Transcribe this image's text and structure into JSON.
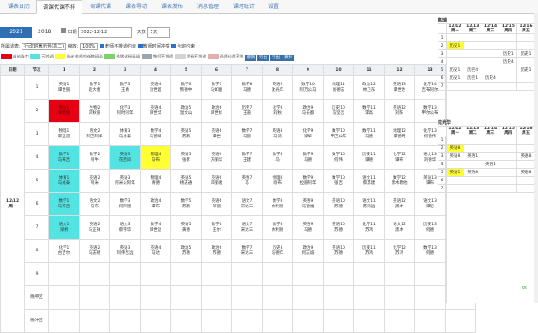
{
  "nav": [
    "课表日历",
    "调课代课不排",
    "调课代课",
    "课表导动",
    "课表发布",
    "消息管理",
    "课时统计",
    "设置"
  ],
  "nav_active": 2,
  "year": {
    "a": "2021",
    "b": "2018"
  },
  "date_label": "日期",
  "date_value": "2022-12-12",
  "days_label": "天数",
  "days_value": "5天",
  "row2": {
    "class_label": "所属课表:",
    "class_value": "行政班满示例(高二)",
    "zoom_label": "缩放:",
    "zoom_value": "100%",
    "opt1": "教师不排课约束",
    "opt2": "教师时间冲突",
    "opt3": "合班约束"
  },
  "legend": [
    {
      "color": "#e60012",
      "label": "当前选中"
    },
    {
      "color": "#54e3e3",
      "label": "可对调"
    },
    {
      "color": "#ffff33",
      "label": "当前老师的任教班级"
    },
    {
      "color": "#7ad36b",
      "label": "关联课程班级"
    },
    {
      "color": "#9aa5ad",
      "label": "教师不排课"
    },
    {
      "color": "#d3d3d3",
      "label": "课程不排课"
    },
    {
      "color": "#e0b0b0",
      "label": "调课代课不排"
    }
  ],
  "buttons": [
    "撤销",
    "导出",
    "导出",
    "教师"
  ],
  "table": {
    "h_date": "日期",
    "h_period": "节次",
    "cols": [
      "1",
      "2",
      "3",
      "4",
      "5",
      "6",
      "7",
      "8",
      "9",
      "10",
      "11",
      "12",
      "13",
      "14"
    ],
    "date": "12/12",
    "weekday": "周一",
    "rows": [
      {
        "p": "1",
        "cells": [
          "英语1\n谭世丽",
          "数学1\n赵大春",
          "数学3\n王清",
          "英语4\n汤世超",
          "数学6\n熊德中",
          "数学7\n马如酸",
          "数学8\n马德",
          "英语9\n沈光年",
          "数学10\n阿万公马",
          "地理11\n尚德志",
          "政治12\n林卫东",
          "英语13\n谭世达",
          "化学14\n吉布阿尔",
          "数学15\n钱小"
        ]
      },
      {
        "p": "2",
        "cells": [
          "英语1\n谭世丽",
          "生物2\n邓秋丽",
          "化学3\n阿时阿年",
          "英语4\n谭世华",
          "政治5\n温文山",
          "政治6\n谭世标",
          "历史7\n王道",
          "化学8\n刘秋",
          "政治9\n马长都",
          "历史10\n马坚吉",
          "数学11\n李高",
          "英语12\n刘阳",
          "数学13\n甲尔公布",
          "生物14\n阿布公布"
        ]
      },
      {
        "p": "3",
        "cells": [
          "物理1\n李正道",
          "语文2\n阿巴阿年",
          "体育3\n马永泰",
          "数学4\n马德华",
          "英语5\n苏鹏",
          "英语6\n谭世",
          "数学7\n马丽",
          "英语8\n马涛",
          "化学9\n梁华",
          "数学10\n甲巴公布",
          "数学11\n马德",
          "地理12\n谭德明",
          "化学13\n何德伟",
          "语文14\n吉布"
        ]
      },
      {
        "p": "4",
        "cells": [
          "数学1\n马布吉",
          "数学2\n阿牛",
          "英语3\n花西凤",
          "物理4\n马布",
          "英语5\n张孝",
          "英语6\n方丽华",
          "数学7\n王建",
          "数学8\n马",
          "数学9\n马德",
          "数学10\n何伟",
          "历史11\n谭德",
          "化学12\n谭布",
          "语文13\n刘德华",
          "数学14\n马布"
        ]
      },
      {
        "p": "5",
        "cells": [
          "体育1\n马永泰",
          "英语2\n阿米",
          "英语3\n阿米公阿年",
          "物理4\n清德",
          "英语5\n杨志通",
          "英语6\n邓丽君",
          "英语7\n马",
          "物理8\n肖布",
          "数学9\n拉丽阿年",
          "数学10\n张吉",
          "语文11\n蔡苏建",
          "数学12\n黑木勒他",
          "英语13\n谭布",
          "英语14\n蔡大"
        ]
      },
      {
        "p": "6",
        "cells": [
          "数学1\n马布吉",
          "语文2\n马布",
          "数学3\n何阿德",
          "政治4\n谭布",
          "数学5\n苏鹏",
          "英语6\n邓丽",
          "语文7\n宋达三",
          "数学8\n余利德",
          "英语9\n马德福",
          "英语10\n苏德",
          "语文11\n苏鸿远",
          "英语12\n黑木",
          "语文13\n谭尼",
          "数学14\n苏大"
        ]
      },
      {
        "p": "7",
        "cells": [
          "语文1\n梁明",
          "英语2\n马正祥",
          "语文3\n蔡宇华",
          "数学4\n谭世远",
          "英语5\n黄德",
          "数学6\n王尔",
          "语文7\n宋达三",
          "数学8\n余利德",
          "英语9\n马德",
          "英语10\n苏德",
          "化学11\n苏鸿",
          "语文12\n黑木",
          "历史13\n何德",
          "政治14\n张布"
        ]
      },
      {
        "p": "8",
        "cells": [
          "化学1\n古吉尔",
          "英语2\n马志德",
          "英语3\n阿伟吉远",
          "英语4\n马达",
          "政治5\n苏德",
          "政治6\n苏德",
          "数学7\n宋达三",
          "历史8\n马德年",
          "政治9\n何志诚",
          "英语10\n苏德",
          "历史11\n苏鸿",
          "化学12\n苏鸿",
          "数学13\n何德",
          "数学14\n苏大"
        ]
      },
      {
        "p": "9",
        "cells": [
          "",
          "",
          "",
          "",
          "",
          "",
          "",
          "",
          "",
          "",
          "",
          "",
          "",
          ""
        ]
      },
      {
        "p": "晚申区",
        "cells": [
          "",
          "",
          "",
          "",
          "",
          "",
          "",
          "",
          "",
          "",
          "",
          "",
          "",
          ""
        ]
      },
      {
        "p": "晚冲区",
        "cells": [
          "",
          "",
          "",
          "",
          "",
          "",
          "",
          "",
          "",
          "",
          "",
          "",
          "",
          ""
        ]
      }
    ]
  },
  "side": {
    "title1": "高瑞",
    "title2": "沈光华",
    "dates": [
      "12/12\n周一",
      "12/13\n周二",
      "12/14\n周三",
      "12/15\n周四",
      "12/16\n周五"
    ],
    "t1": [
      [
        "",
        "",
        "",
        "",
        ""
      ],
      [
        "历史1",
        "",
        "",
        "",
        ""
      ],
      [
        "",
        "",
        "",
        "历史1",
        "历史1"
      ],
      [
        "",
        "",
        "",
        "历史4",
        ""
      ],
      [
        "历史1",
        "历史4",
        "",
        "",
        "历史1"
      ],
      [
        "历史1",
        "历史1",
        "历史4",
        "",
        ""
      ],
      [
        "",
        "",
        "",
        "",
        ""
      ]
    ],
    "t2": [
      [
        "",
        "",
        "",
        "",
        ""
      ],
      [
        "英语8",
        "",
        "",
        "",
        ""
      ],
      [
        "英语8",
        "英语1",
        "",
        "",
        "英语8"
      ],
      [
        "",
        "",
        "英语1",
        "",
        ""
      ],
      [
        "英语1",
        "英语8",
        "",
        "",
        "英语8"
      ],
      [
        "",
        "",
        "",
        "",
        ""
      ],
      [
        "",
        "",
        "",
        "",
        ""
      ]
    ]
  },
  "status_ok": "ok"
}
